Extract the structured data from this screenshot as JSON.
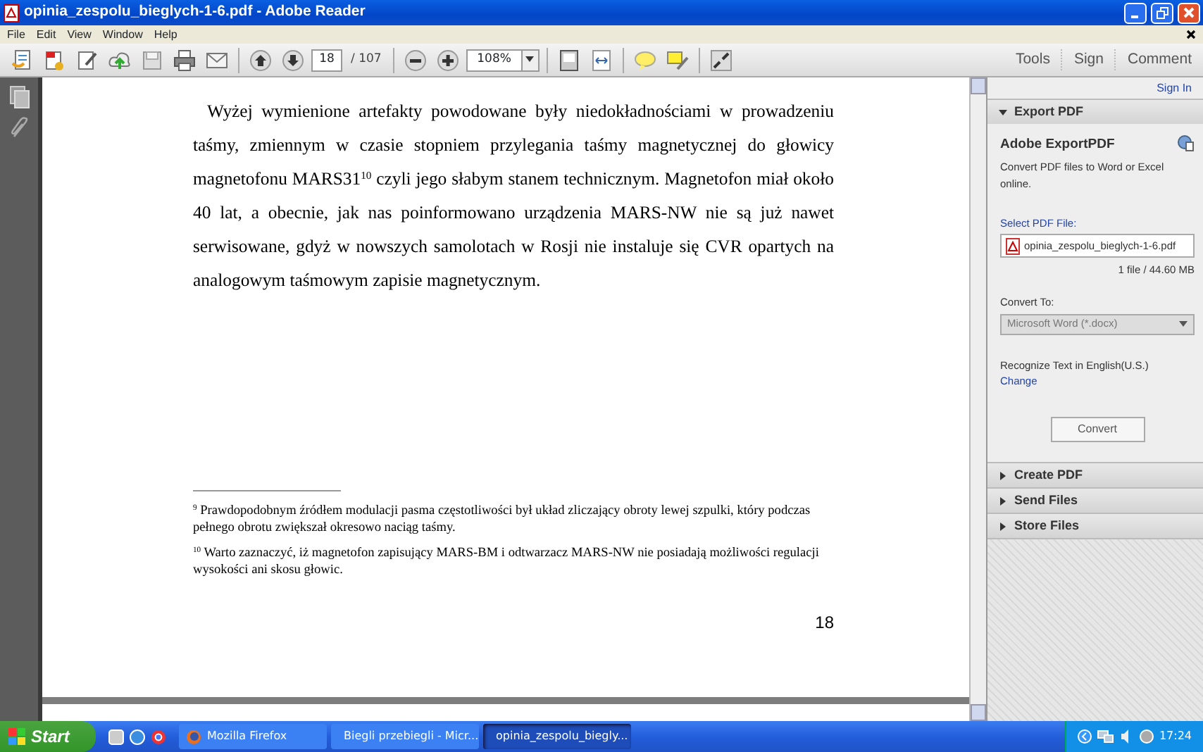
{
  "window": {
    "title": "opinia_zespolu_bieglych-1-6.pdf - Adobe Reader"
  },
  "menu": [
    "File",
    "Edit",
    "View",
    "Window",
    "Help"
  ],
  "toolbar": {
    "page": "18",
    "page_total": "/ 107",
    "zoom": "108%",
    "tabs": [
      "Tools",
      "Sign",
      "Comment"
    ]
  },
  "document": {
    "paragraph": "Wyżej wymienione artefakty powodowane były niedokładnościami w prowadzeniu taśmy,  zmiennym w czasie stopniem przylegania taśmy magnetycznej do głowicy magnetofonu MARS31$^{10}$ czyli jego słabym stanem technicznym. Magnetofon miał około 40 lat, a obecnie, jak nas poinformowano urządzenia MARS-NW nie są już nawet serwisowane, gdyż w nowszych samolotach w Rosji nie instaluje się CVR opartych na analogowym taśmowym zapisie magnetycznym.",
    "footnotes": [
      "$^{9}$ Prawdopodobnym źródłem modulacji pasma częstotliwości był układ zliczający obroty lewej szpulki, który podczas pełnego obrotu zwiększał okresowo naciąg taśmy.",
      "$^{10}$ Warto zaznaczyć, iż magnetofon zapisujący MARS-BM i odtwarzacz MARS-NW nie posiadają możliwości regulacji wysokości ani skosu głowic."
    ],
    "page_number": "18"
  },
  "right_pane": {
    "sign_in": "Sign In",
    "sections": [
      {
        "title": "Export PDF",
        "expanded": true
      },
      {
        "title": "Create PDF",
        "expanded": false
      },
      {
        "title": "Send Files",
        "expanded": false
      },
      {
        "title": "Store Files",
        "expanded": false
      }
    ],
    "export": {
      "heading": "Adobe ExportPDF",
      "description": "Convert PDF files to Word or Excel online.",
      "select_label": "Select PDF File:",
      "file": "opinia_zespolu_bieglych-1-6.pdf",
      "file_info": "1 file / 44.60 MB",
      "convert_to_label": "Convert To:",
      "convert_to": "Microsoft Word (*.docx)",
      "recognize": "Recognize Text in English(U.S.)",
      "change": "Change",
      "button": "Convert"
    }
  },
  "taskbar": {
    "start": "Start",
    "tasks": [
      {
        "label": "Mozilla Firefox",
        "selected": false
      },
      {
        "label": "Biegli przebiegli - Micr...",
        "selected": false
      },
      {
        "label": "opinia_zespolu_biegly...",
        "selected": true
      }
    ],
    "clock": "17:24"
  }
}
